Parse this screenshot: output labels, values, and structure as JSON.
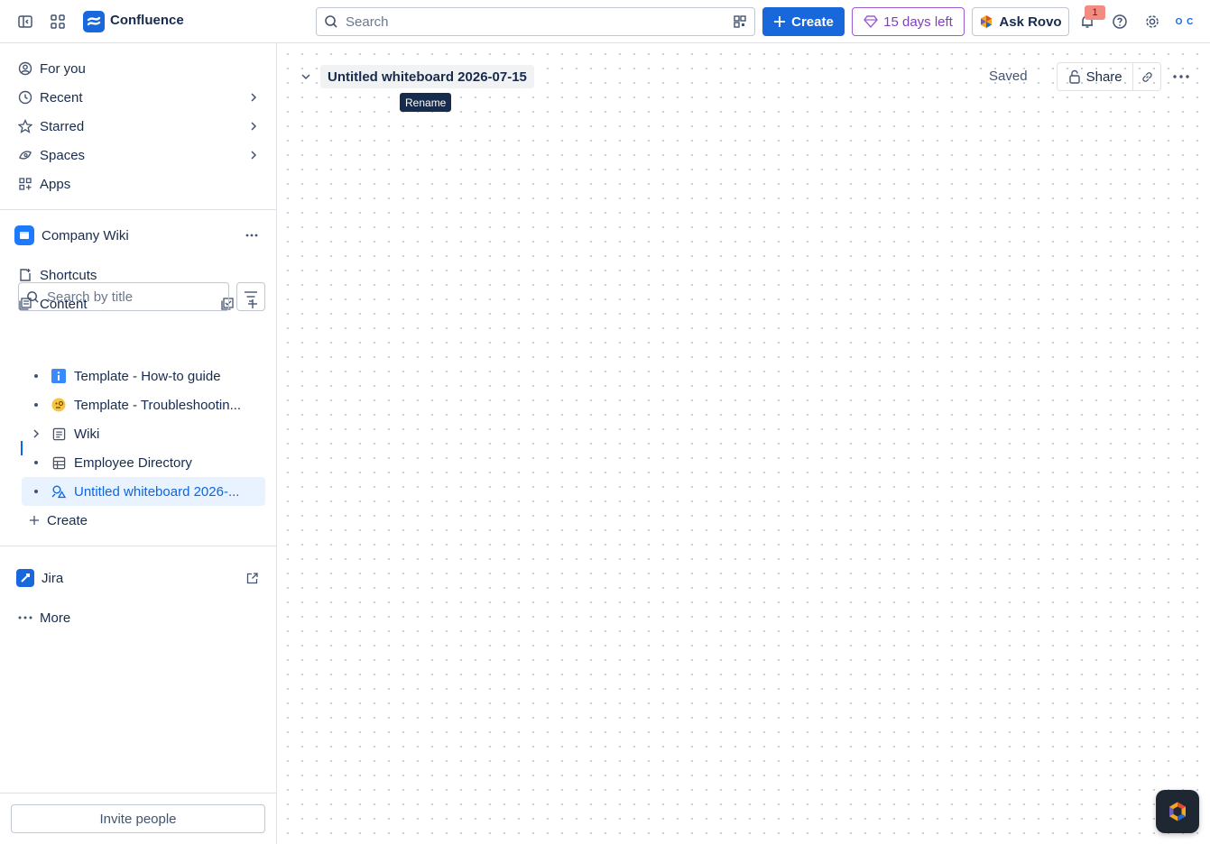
{
  "topbar": {
    "app_name": "Confluence",
    "search_placeholder": "Search",
    "create_label": "Create",
    "trial_label": "15 days left",
    "rovo_label": "Ask Rovo",
    "notification_count": "1",
    "avatar_initials": "O C"
  },
  "sidebar": {
    "nav": [
      {
        "label": "For you",
        "icon": "user-circle-icon"
      },
      {
        "label": "Recent",
        "icon": "clock-icon"
      },
      {
        "label": "Starred",
        "icon": "star-icon"
      },
      {
        "label": "Spaces",
        "icon": "spaces-icon"
      },
      {
        "label": "Apps",
        "icon": "apps-icon"
      }
    ],
    "space_name": "Company Wiki",
    "shortcuts_label": "Shortcuts",
    "content_label": "Content",
    "title_search_placeholder": "Search by title",
    "tree": [
      {
        "label": "Template - How-to guide",
        "icon": "info-icon"
      },
      {
        "label": "Template - Troubleshootin...",
        "icon": "emoji-icon"
      },
      {
        "label": "Wiki",
        "icon": "page-icon"
      },
      {
        "label": "Employee Directory",
        "icon": "table-icon"
      },
      {
        "label": "Untitled whiteboard 2026-...",
        "icon": "whiteboard-icon"
      }
    ],
    "create_label": "Create",
    "jira_label": "Jira",
    "more_label": "More",
    "invite_label": "Invite people"
  },
  "whiteboard": {
    "title": "Untitled whiteboard 2026-07-15",
    "tooltip": "Rename",
    "status": "Saved",
    "share_label": "Share"
  },
  "colors": {
    "brand": "#1868db",
    "trial": "#9c5bd3",
    "active_bg": "#e9f2ff",
    "active_text": "#0c66e4"
  }
}
